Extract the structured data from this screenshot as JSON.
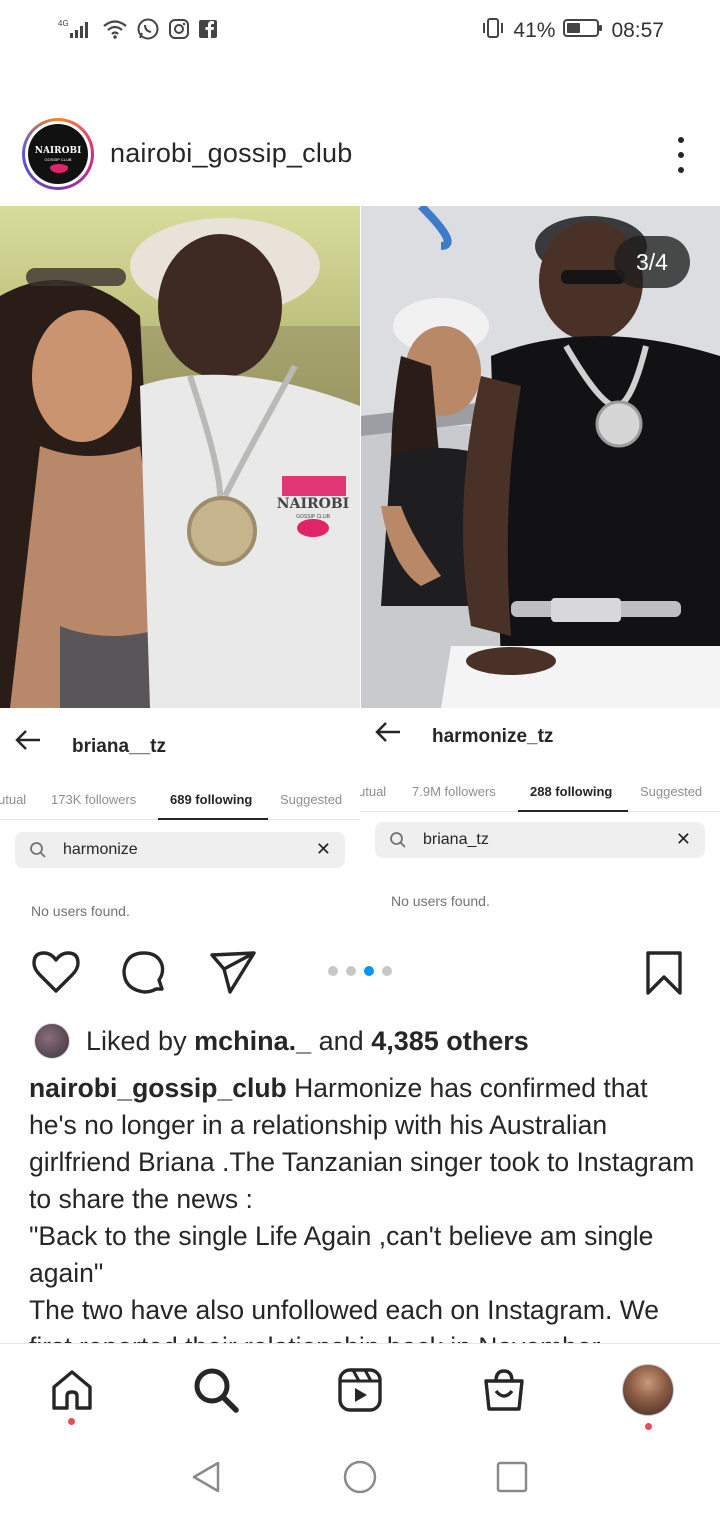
{
  "status_bar": {
    "network": "4G",
    "battery_percent": "41%",
    "time": "08:57",
    "icons": [
      "signal-icon",
      "wifi-icon",
      "whatsapp-icon",
      "instagram-icon",
      "facebook-icon",
      "vibrate-icon",
      "battery-icon"
    ]
  },
  "post": {
    "username": "nairobi_gossip_club",
    "avatar_text": "NAIROBI",
    "avatar_subtext": "GOSSIP CLUB",
    "slide_counter": "3/4",
    "watermark_title": "NAIROBI",
    "watermark_sub": "GOSSIP CLUB"
  },
  "panel_left": {
    "title": "briana__tz",
    "tabs": [
      "utual",
      "173K followers",
      "689 following",
      "Suggested"
    ],
    "active_tab": 2,
    "search_value": "harmonize",
    "empty_text": "No users found."
  },
  "panel_right": {
    "title": "harmonize_tz",
    "tabs": [
      "utual",
      "7.9M followers",
      "288 following",
      "Suggested"
    ],
    "active_tab": 2,
    "search_value": "briana_tz",
    "empty_text": "No users found."
  },
  "carousel": {
    "count": 4,
    "active": 2
  },
  "likes": {
    "prefix": "Liked by ",
    "user": "mchina._",
    "middle": " and ",
    "others": "4,385 others"
  },
  "caption": {
    "username": "nairobi_gossip_club",
    "line1": " Harmonize has confirmed that he's no longer in a relationship with his Australian girlfriend Briana .The Tanzanian singer took to Instagram to share the news :",
    "line2": "\"Back to the single Life Again ,can't believe am single again\"",
    "line3": "The two have also unfollowed each on Instagram. We first reported their relationship back in November"
  },
  "bottom_nav": {
    "items": [
      "home-icon",
      "search-icon",
      "reels-icon",
      "shop-icon",
      "profile-avatar"
    ]
  },
  "colors": {
    "accent_blue": "#0095f6",
    "notification_red": "#ed4956",
    "text": "#262626",
    "secondary_text": "#8e8e8e"
  }
}
